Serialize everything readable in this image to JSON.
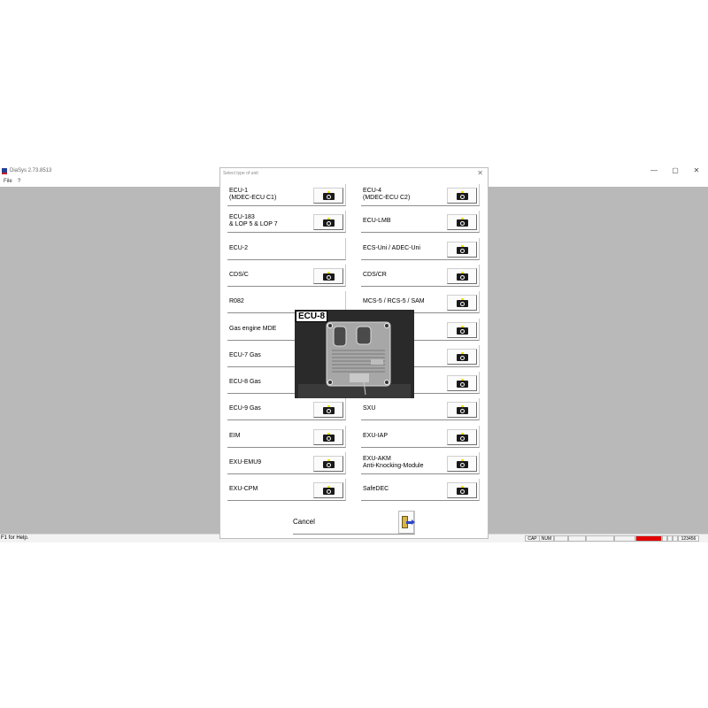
{
  "window": {
    "title": "DiaSys 2.73.8513",
    "controls": {
      "minimize": "—",
      "maximize": "▢",
      "close": "✕"
    }
  },
  "menu": [
    "File",
    "?"
  ],
  "dialog": {
    "title": "Select type of unit",
    "close_icon": "✕",
    "left_column": [
      {
        "line1": "ECU-1",
        "line2": "(MDEC-ECU C1)"
      },
      {
        "line1": "ECU-183",
        "line2": "& LOP 5 & LOP 7"
      },
      {
        "line1": "ECU-2",
        "line2": ""
      },
      {
        "line1": "CDS/C",
        "line2": ""
      },
      {
        "line1": "R082",
        "line2": ""
      },
      {
        "line1": "Gas engine MDE",
        "line2": ""
      },
      {
        "line1": "ECU-7 Gas",
        "line2": ""
      },
      {
        "line1": "ECU-8 Gas",
        "line2": ""
      },
      {
        "line1": "ECU-9 Gas",
        "line2": ""
      },
      {
        "line1": "EIM",
        "line2": ""
      },
      {
        "line1": "EXU-EMU9",
        "line2": ""
      },
      {
        "line1": "EXU-CPM",
        "line2": ""
      }
    ],
    "right_column": [
      {
        "line1": "ECU-4",
        "line2": "(MDEC-ECU C2)"
      },
      {
        "line1": "ECU-LMB",
        "line2": ""
      },
      {
        "line1": "ECS-Uni / ADEC-Uni",
        "line2": ""
      },
      {
        "line1": "CDS/CR",
        "line2": ""
      },
      {
        "line1": "MCS-5 / RCS-5 / SAM",
        "line2": ""
      },
      {
        "line1": "",
        "line2": ""
      },
      {
        "line1": "",
        "line2": ""
      },
      {
        "line1": "",
        "line2": ""
      },
      {
        "line1": "SXU",
        "line2": ""
      },
      {
        "line1": "EXU-IAP",
        "line2": ""
      },
      {
        "line1": "EXU-AKM",
        "line2": "Anti-Knocking-Module"
      },
      {
        "line1": "SafeDEC",
        "line2": ""
      }
    ],
    "left_buttons_visible": [
      true,
      true,
      false,
      true,
      false,
      false,
      false,
      false,
      true,
      true,
      true,
      true
    ],
    "cancel_label": "Cancel",
    "camera_icon": "camera-icon",
    "exit_icon": "exit-door-icon"
  },
  "preview": {
    "label": "ECU-8"
  },
  "status": {
    "help": "F1 for Help.",
    "cap": "CAP",
    "num": "NUM",
    "code": "123456",
    "alert_color": "#e00000"
  }
}
